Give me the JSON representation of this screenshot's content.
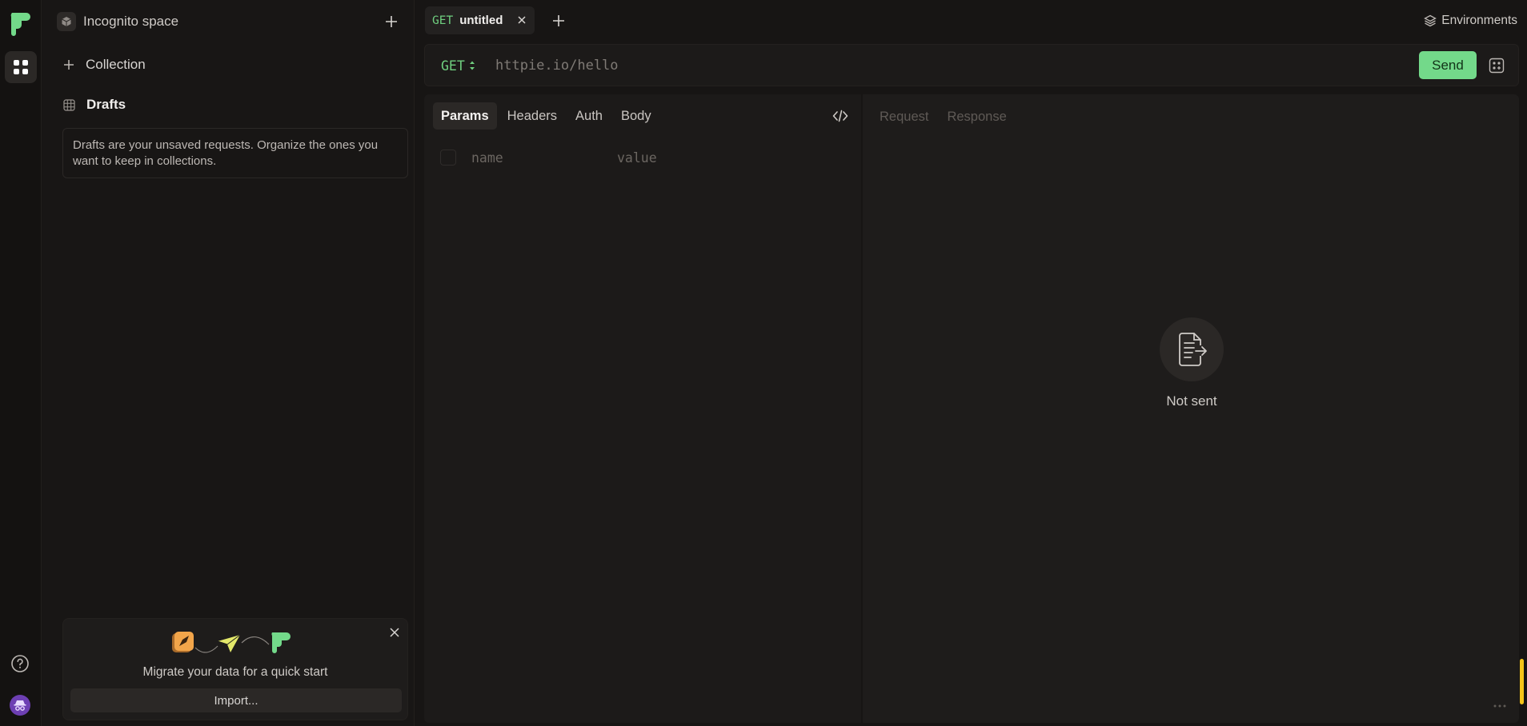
{
  "sidebar": {
    "space_name": "Incognito space",
    "collection_label": "Collection",
    "drafts_label": "Drafts",
    "drafts_info": "Drafts are your unsaved requests. Organize the ones you want to keep in collections.",
    "migrate": {
      "text": "Migrate your data for a quick start",
      "import_label": "Import..."
    }
  },
  "tabs": [
    {
      "method": "GET",
      "title": "untitled"
    }
  ],
  "header": {
    "environments_label": "Environments"
  },
  "request": {
    "method": "GET",
    "url_placeholder": "httpie.io/hello",
    "send_label": "Send",
    "tabs": [
      "Params",
      "Headers",
      "Auth",
      "Body"
    ],
    "active_tab": "Params",
    "param_name_placeholder": "name",
    "param_value_placeholder": "value"
  },
  "response": {
    "tabs": [
      "Request",
      "Response"
    ],
    "status": "Not sent"
  },
  "colors": {
    "accent_green": "#73d98a",
    "method_green": "#6fcf7f",
    "avatar_purple": "#6d3fb3",
    "scroll_yellow": "#f5c518"
  },
  "icons": [
    "logo-icon",
    "grid-icon",
    "help-icon",
    "incognito-icon",
    "cube-icon",
    "plus-icon",
    "drafts-grid-icon",
    "close-icon",
    "layers-icon",
    "sort-arrows-icon",
    "save-icon",
    "code-icon",
    "document-send-icon",
    "more-icon"
  ]
}
